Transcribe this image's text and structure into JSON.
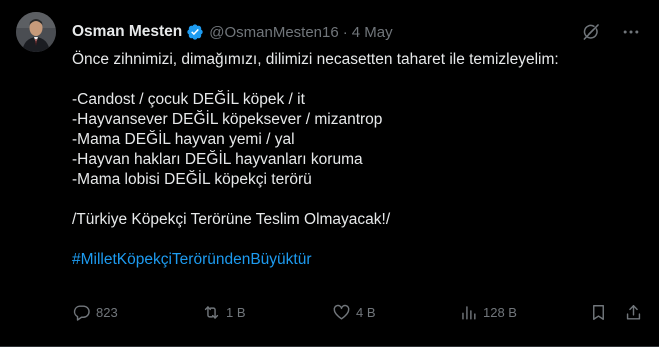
{
  "author": {
    "display_name": "Osman Mesten",
    "handle": "@OsmanMesten16",
    "separator": "·",
    "time": "4 May"
  },
  "icons": {
    "verified": "verified-badge-icon",
    "grok": "grok-icon",
    "more": "more-icon",
    "reply": "reply-icon",
    "repost": "repost-icon",
    "like": "like-icon",
    "views": "views-icon",
    "bookmark": "bookmark-icon",
    "share": "share-icon"
  },
  "colors": {
    "background": "#000000",
    "text": "#e7e9ea",
    "muted": "#71767b",
    "hashtag": "#1d9bf0",
    "verified": "#1d9bf0"
  },
  "body": {
    "intro": "Önce zihnimizi, dimağımızı, dilimizi necasetten taharet ile temizleyelim:",
    "lines": [
      "-Candost / çocuk DEĞİL köpek / it",
      "-Hayvansever DEĞİL köpeksever / mizantrop",
      "-Mama DEĞİL hayvan yemi / yal",
      "-Hayvan hakları DEĞİL hayvanları koruma",
      "-Mama lobisi DEĞİL köpekçi terörü"
    ],
    "slogan": "/Türkiye Köpekçi Terörüne Teslim Olmayacak!/",
    "hashtag": "#MilletKöpekçiTeröründenBüyüktür"
  },
  "metrics": {
    "replies": "823",
    "reposts": "1 B",
    "likes": "4 B",
    "views": "128 B"
  }
}
